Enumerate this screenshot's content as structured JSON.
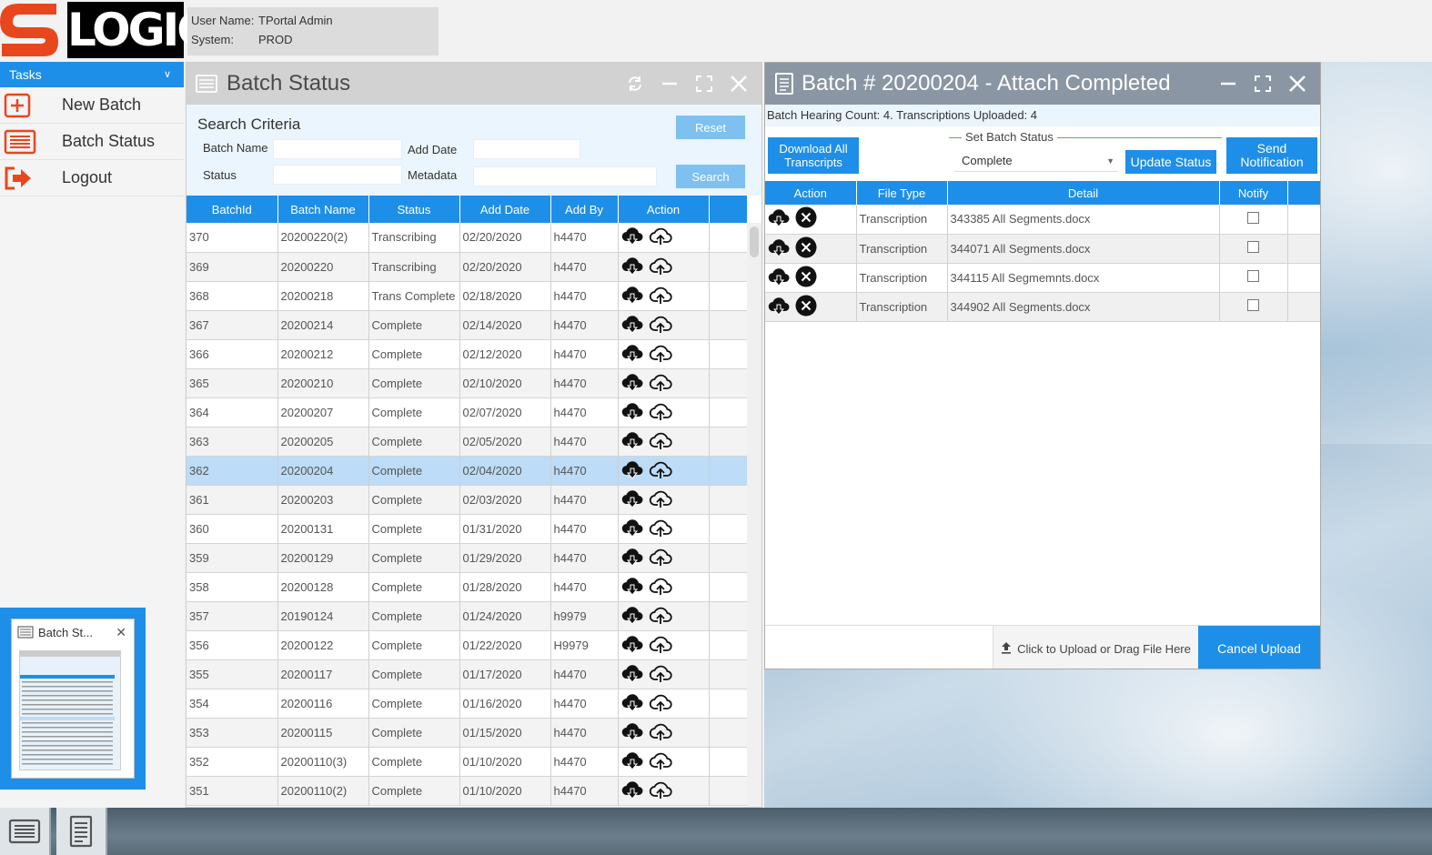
{
  "brand": {
    "logo_letter": "S",
    "logo_word": "LOGIC",
    "logo_color": "#e8471e"
  },
  "user": {
    "name_label": "User Name:",
    "name_value": "TPortal Admin",
    "system_label": "System:",
    "system_value": "PROD"
  },
  "sidebar": {
    "tasks_label": "Tasks",
    "items": [
      {
        "label": "New Batch",
        "icon": "plus-square-icon"
      },
      {
        "label": "Batch Status",
        "icon": "list-icon"
      },
      {
        "label": "Logout",
        "icon": "logout-icon"
      }
    ],
    "thumbnail_title": "Batch St..."
  },
  "batch_status": {
    "title": "Batch Status",
    "search": {
      "title": "Search Criteria",
      "batch_name_label": "Batch Name",
      "add_date_label": "Add Date",
      "status_label": "Status",
      "metadata_label": "Metadata",
      "reset_label": "Reset",
      "search_label": "Search"
    },
    "columns": [
      "BatchId",
      "Batch Name",
      "Status",
      "Add Date",
      "Add By",
      "Action"
    ],
    "rows": [
      [
        "370",
        "20200220(2)",
        "Transcribing",
        "02/20/2020",
        "h4470"
      ],
      [
        "369",
        "20200220",
        "Transcribing",
        "02/20/2020",
        "h4470"
      ],
      [
        "368",
        "20200218",
        "Trans Complete",
        "02/18/2020",
        "h4470"
      ],
      [
        "367",
        "20200214",
        "Complete",
        "02/14/2020",
        "h4470"
      ],
      [
        "366",
        "20200212",
        "Complete",
        "02/12/2020",
        "h4470"
      ],
      [
        "365",
        "20200210",
        "Complete",
        "02/10/2020",
        "h4470"
      ],
      [
        "364",
        "20200207",
        "Complete",
        "02/07/2020",
        "h4470"
      ],
      [
        "363",
        "20200205",
        "Complete",
        "02/05/2020",
        "h4470"
      ],
      [
        "362",
        "20200204",
        "Complete",
        "02/04/2020",
        "h4470"
      ],
      [
        "361",
        "20200203",
        "Complete",
        "02/03/2020",
        "h4470"
      ],
      [
        "360",
        "20200131",
        "Complete",
        "01/31/2020",
        "h4470"
      ],
      [
        "359",
        "20200129",
        "Complete",
        "01/29/2020",
        "h4470"
      ],
      [
        "358",
        "20200128",
        "Complete",
        "01/28/2020",
        "h4470"
      ],
      [
        "357",
        "20190124",
        "Complete",
        "01/24/2020",
        "h9979"
      ],
      [
        "356",
        "20200122",
        "Complete",
        "01/22/2020",
        "H9979"
      ],
      [
        "355",
        "20200117",
        "Complete",
        "01/17/2020",
        "h4470"
      ],
      [
        "354",
        "20200116",
        "Complete",
        "01/16/2020",
        "h4470"
      ],
      [
        "353",
        "20200115",
        "Complete",
        "01/15/2020",
        "h4470"
      ],
      [
        "352",
        "20200110(3)",
        "Complete",
        "01/10/2020",
        "h4470"
      ],
      [
        "351",
        "20200110(2)",
        "Complete",
        "01/10/2020",
        "h4470"
      ]
    ],
    "selected_batch_id": "362"
  },
  "detail": {
    "title": "Batch # 20200204 - Attach Completed",
    "info": "Batch Hearing Count: 4. Transcriptions Uploaded: 4",
    "download_all_label": "Download All Transcripts",
    "set_status_legend": "Set Batch Status",
    "status_value": "Complete",
    "update_status_label": "Update Status",
    "send_notification_label": "Send Notification",
    "columns": [
      "Action",
      "File Type",
      "Detail",
      "Notify"
    ],
    "rows": [
      {
        "file_type": "Transcription",
        "detail": "343385 All Segments.docx",
        "notify": false
      },
      {
        "file_type": "Transcription",
        "detail": "344071 All Segments.docx",
        "notify": false
      },
      {
        "file_type": "Transcription",
        "detail": "344115 All Segmemnts.docx",
        "notify": false
      },
      {
        "file_type": "Transcription",
        "detail": "344902 All Segments.docx",
        "notify": false
      }
    ],
    "upload_label": "Click to Upload or Drag File Here",
    "cancel_upload_label": "Cancel Upload"
  },
  "colors": {
    "accent": "#1e8fe8",
    "selected_row": "#bcdcf7",
    "title_bar_detail": "#8a96a3"
  }
}
